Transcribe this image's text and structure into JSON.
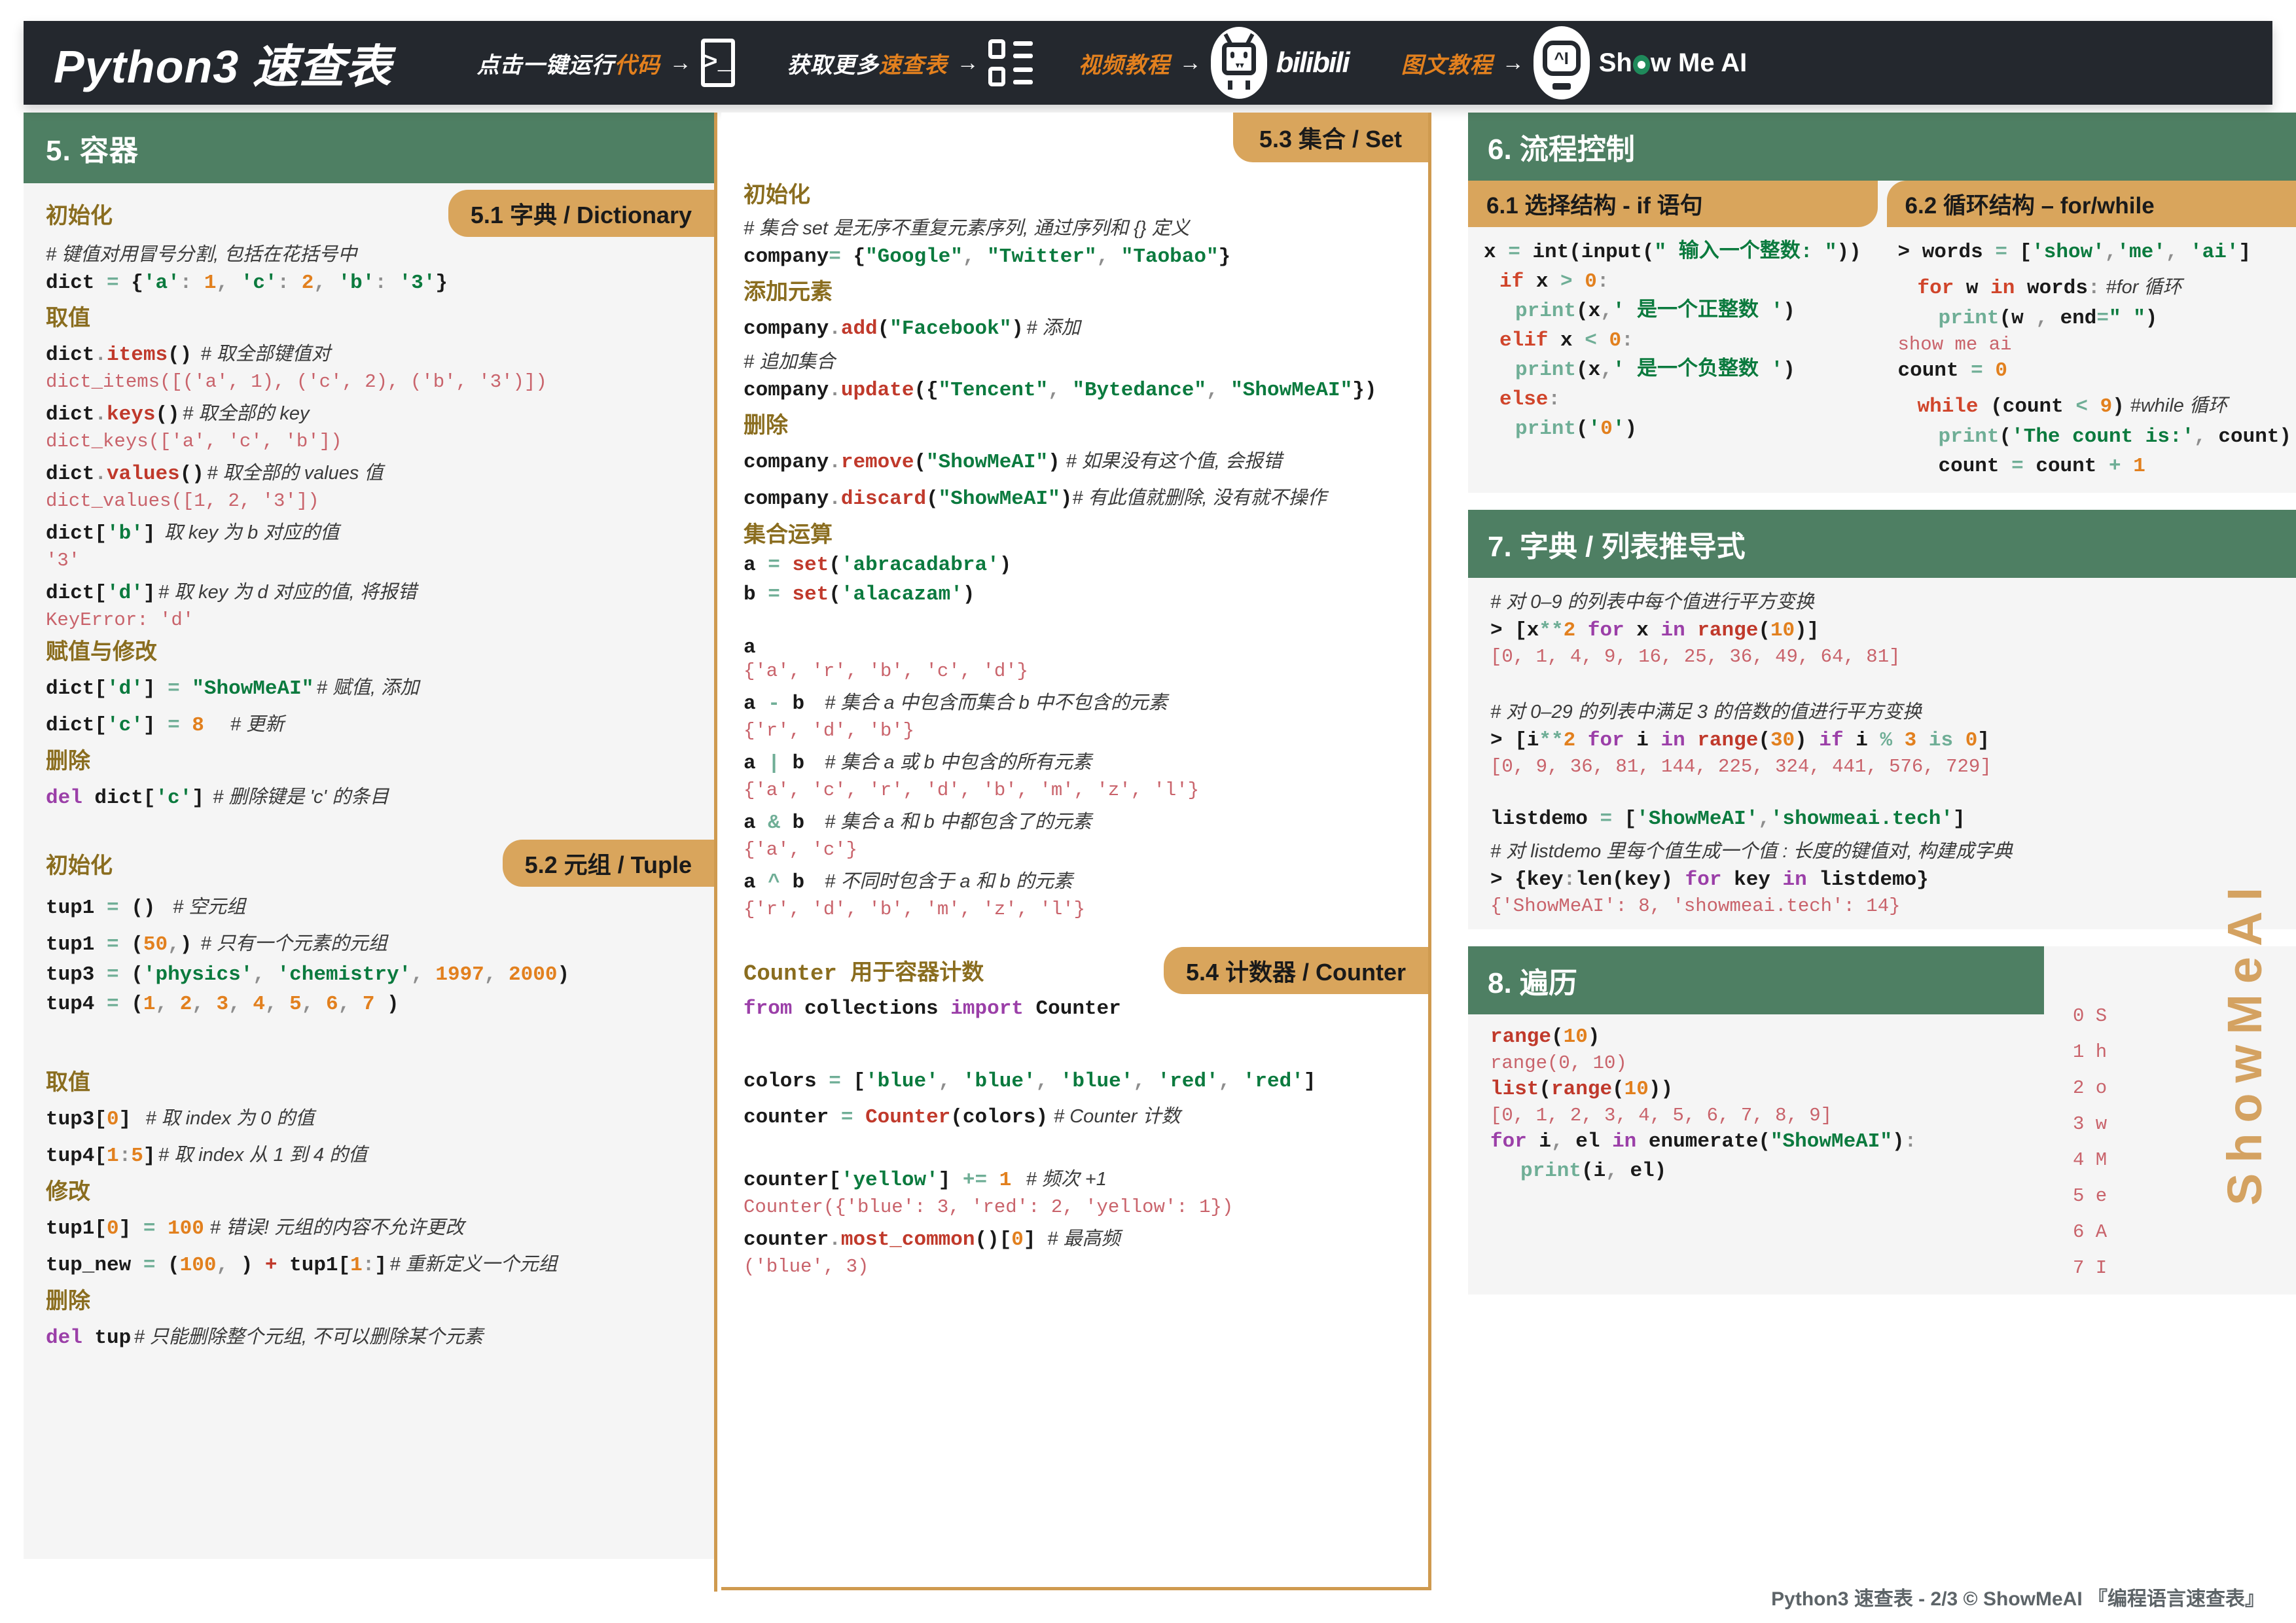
{
  "header": {
    "title": "Python3 速查表",
    "items": [
      {
        "label_pre": "点击一键运行",
        "label_accent": "代码",
        "icon": "terminal-icon"
      },
      {
        "label_pre": "获取更多",
        "label_accent": "速查表",
        "icon": "list-icon"
      },
      {
        "label_accent": "视频教程",
        "label_pre": "",
        "icon": "bilibili-icon",
        "wordmark": "bilibili"
      },
      {
        "label_accent": "图文教程",
        "label_pre": "",
        "icon": "showmeai-robot-icon",
        "wordmark_a": "Sh",
        "wordmark_b": "w Me AI",
        "robot_face": "^I"
      }
    ],
    "arrow": "→",
    "colors": {
      "bar": "#24282e",
      "accent": "#e2801e",
      "green": "#1f8a5b"
    }
  },
  "section5": {
    "heading": "5. 容器",
    "dict": {
      "pill": "5.1 字典 / Dictionary",
      "sub_init": "初始化",
      "cmt_init": "# 键值对用冒号分割, 包括在花括号中",
      "code_init": "dict = {'a': 1, 'c': 2, 'b': '3'}",
      "sub_get": "取值",
      "rows": [
        {
          "code": "dict.items()",
          "cmt": "# 取全部键值对",
          "out": "dict_items([('a', 1), ('c', 2), ('b', '3')])"
        },
        {
          "code": "dict.keys()",
          "cmt": "# 取全部的 key",
          "out": "dict_keys(['a', 'c', 'b'])"
        },
        {
          "code": "dict.values()",
          "cmt": "# 取全部的 values 值",
          "out": "dict_values([1, 2, '3'])"
        },
        {
          "code": "dict['b']",
          "cmt": "取 key 为 b 对应的值",
          "out": "'3'"
        },
        {
          "code": "dict['d']",
          "cmt": "# 取 key 为 d 对应的值, 将报错",
          "out": "KeyError: 'd'"
        }
      ],
      "sub_assign": "赋值与修改",
      "assign": [
        {
          "code": "dict['d'] = \"ShowMeAI\"",
          "cmt": "# 赋值, 添加"
        },
        {
          "code": "dict['c'] = 8",
          "cmt": "# 更新"
        }
      ],
      "sub_del": "删除",
      "del": {
        "code": "del dict['c']",
        "cmt": "# 删除键是 'c' 的条目"
      }
    },
    "tuple": {
      "pill": "5.2 元组 / Tuple",
      "sub_init": "初始化",
      "init": [
        {
          "code": "tup1 = ()",
          "cmt": "# 空元组"
        },
        {
          "code": "tup1 = (50,)",
          "cmt": "# 只有一个元素的元组"
        },
        {
          "code": "tup3 = ('physics', 'chemistry', 1997, 2000)",
          "cmt": ""
        },
        {
          "code": "tup4 = (1, 2, 3, 4, 5, 6, 7 )",
          "cmt": ""
        }
      ],
      "sub_get": "取值",
      "get": [
        {
          "code": "tup3[0]",
          "cmt": "# 取 index 为 0 的值"
        },
        {
          "code": "tup4[1:5]",
          "cmt": "# 取 index 从 1 到 4 的值"
        }
      ],
      "sub_mod": "修改",
      "mod": [
        {
          "code": "tup1[0] = 100",
          "cmt": "# 错误! 元组的内容不允许更改"
        },
        {
          "code": "tup_new = (100, ) + tup1[1:]",
          "cmt": "# 重新定义一个元组"
        }
      ],
      "sub_del": "删除",
      "del": {
        "code": "del tup",
        "cmt": "# 只能删除整个元组, 不可以删除某个元素"
      }
    },
    "set": {
      "pill": "5.3 集合 / Set",
      "sub_init": "初始化",
      "cmt_init": "# 集合 set 是无序不重复元素序列, 通过序列和 {} 定义",
      "code_init": "company= {\"Google\", \"Twitter\", \"Taobao\"}",
      "sub_add": "添加元素",
      "code_add": "company.add(\"Facebook\")",
      "cmt_add": "# 添加",
      "cmt_update": "# 追加集合",
      "code_update": "company.update({\"Tencent\", \"Bytedance\", \"ShowMeAI\"})",
      "sub_del": "删除",
      "code_remove": "company.remove(\"ShowMeAI\")",
      "cmt_remove": "# 如果没有这个值, 会报错",
      "code_discard": "company.discard(\"ShowMeAI\")",
      "cmt_discard": "# 有此值就删除, 没有就不操作",
      "sub_ops": "集合运算",
      "code_a": "a = set('abracadabra')",
      "code_b": "b = set('alacazam')",
      "ops": [
        {
          "code": "a",
          "cmt": "",
          "out": "{'a', 'r', 'b', 'c', 'd'}"
        },
        {
          "code": "a - b",
          "cmt": "# 集合 a 中包含而集合 b 中不包含的元素",
          "out": "{'r', 'd', 'b'}"
        },
        {
          "code": "a | b",
          "cmt": "# 集合 a 或 b 中包含的所有元素",
          "out": "{'a', 'c', 'r', 'd', 'b', 'm', 'z', 'l'}"
        },
        {
          "code": "a & b",
          "cmt": "# 集合 a 和 b 中都包含了的元素",
          "out": "{'a', 'c'}"
        },
        {
          "code": "a ^ b",
          "cmt": "# 不同时包含于 a 和 b 的元素",
          "out": "{'r', 'd', 'b', 'm', 'z', 'l'}"
        }
      ]
    },
    "counter": {
      "pill": "5.4 计数器 / Counter",
      "sub": "Counter 用于容器计数",
      "code_import": "from collections import Counter",
      "code_colors": "colors = ['blue', 'blue', 'blue', 'red', 'red']",
      "code_counter": "counter = Counter(colors)",
      "cmt_counter": "# Counter 计数",
      "code_inc": "counter['yellow'] += 1",
      "cmt_inc": "# 频次 +1",
      "out_inc": "Counter({'blue': 3, 'red': 2, 'yellow': 1})",
      "code_most": "counter.most_common()[0]",
      "cmt_most": "# 最高频",
      "out_most": "('blue', 3)"
    }
  },
  "section6": {
    "heading": "6. 流程控制",
    "pill_if": "6.1 选择结构 - if 语句",
    "pill_loop": "6.2 循环结构 – for/while",
    "if_lines": [
      "x = int(input(\" 输入一个整数: \"))",
      "if x > 0:",
      "print(x,' 是一个正整数 ')",
      "elif x < 0:",
      "print(x,' 是一个负整数 ')",
      "else:",
      "print('0')"
    ],
    "loop_lines": [
      "> words = ['show','me', 'ai']",
      "for w in words:   #for 循环",
      "print(w , end=\" \")",
      "show me ai",
      "count = 0",
      "while (count < 9)  #while 循环",
      "print('The count is:', count)",
      "count = count + 1"
    ]
  },
  "section7": {
    "heading": "7. 字典 / 列表推导式",
    "cmt1": "# 对 0–9 的列表中每个值进行平方变换",
    "code1": "> [x**2 for x in range(10)]",
    "out1": "[0, 1, 4, 9, 16, 25, 36, 49, 64, 81]",
    "cmt2": "# 对 0–29 的列表中满足 3 的倍数的值进行平方变换",
    "code2": "> [i**2 for i in range(30) if i % 3 is 0]",
    "out2": "[0, 9, 36, 81, 144, 225, 324, 441, 576, 729]",
    "code3": "listdemo = ['ShowMeAI','showmeai.tech']",
    "cmt3": "# 对 listdemo 里每个值生成一个值 : 长度的键值对, 构建成字典",
    "code4": "> {key:len(key) for key in listdemo}",
    "out4": "{'ShowMeAI': 8, 'showmeai.tech': 14}"
  },
  "section8": {
    "heading": "8. 遍历",
    "code_range": "range(10)",
    "out_range": "range(0, 10)",
    "code_list": "list(range(10))",
    "out_list": "[0, 1, 2, 3, 4, 5, 6, 7, 8, 9]",
    "code_for": "for i, el in enumerate(\"ShowMeAI\"):",
    "code_print": "print(i, el)",
    "enum_out": [
      "0 S",
      "1 h",
      "2 o",
      "3 w",
      "4 M",
      "5 e",
      "6 A",
      "7 I"
    ]
  },
  "watermark": "ShowMeAI",
  "footer": "Python3 速查表 - 2/3  © ShowMeAI 『编程语言速查表』"
}
